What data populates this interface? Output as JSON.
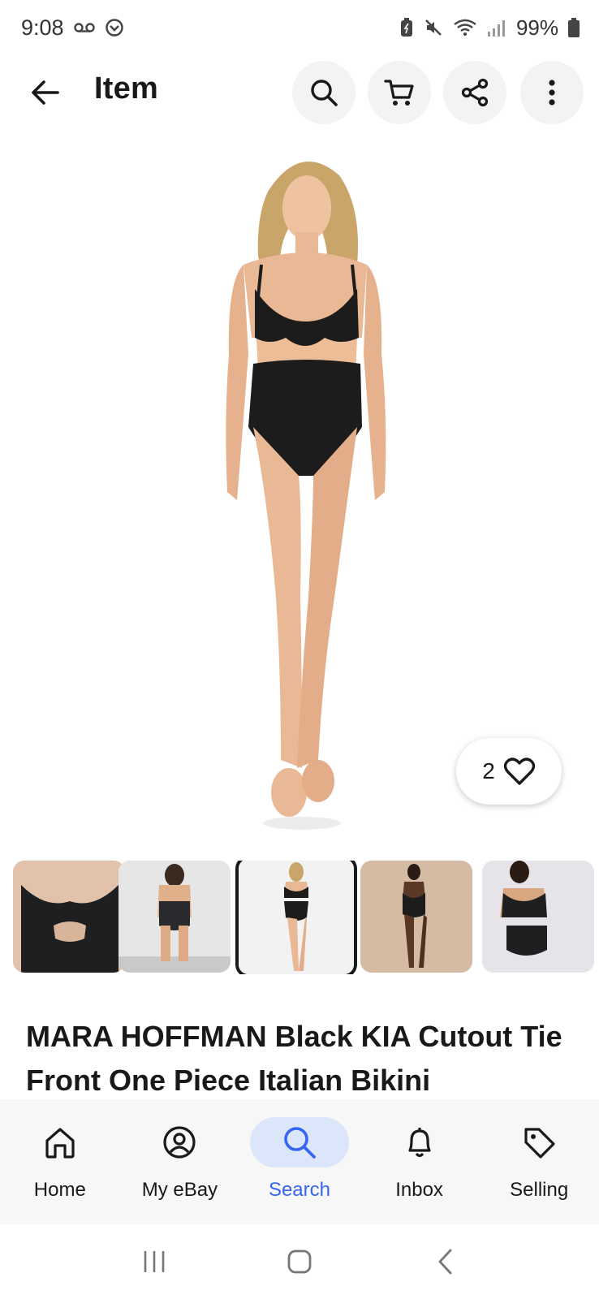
{
  "status_bar": {
    "time": "9:08",
    "battery": "99%"
  },
  "header": {
    "title": "Item"
  },
  "watchers": {
    "count": "2"
  },
  "item": {
    "title": "MARA HOFFMAN Black KIA Cutout Tie Front One Piece Italian Bikini"
  },
  "thumbnails": {
    "count": 5,
    "selected_index": 2
  },
  "bottom_nav": {
    "items": [
      {
        "label": "Home",
        "icon": "home-icon"
      },
      {
        "label": "My eBay",
        "icon": "account-icon"
      },
      {
        "label": "Search",
        "icon": "search-icon"
      },
      {
        "label": "Inbox",
        "icon": "bell-icon"
      },
      {
        "label": "Selling",
        "icon": "tag-icon"
      }
    ],
    "active_index": 2
  },
  "colors": {
    "accent": "#3665f3",
    "active_bg": "#dbe6fb",
    "text": "#191919"
  }
}
